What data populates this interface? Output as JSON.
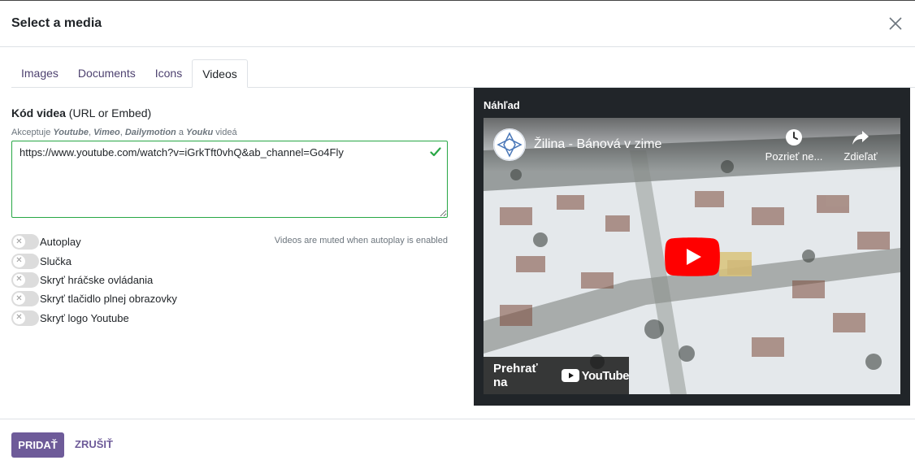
{
  "dialog": {
    "title": "Select a media"
  },
  "tabs": [
    {
      "label": "Images"
    },
    {
      "label": "Documents"
    },
    {
      "label": "Icons"
    },
    {
      "label": "Videos",
      "active": true
    }
  ],
  "form": {
    "label_bold": "Kód videa",
    "label_rest": " (URL or Embed)",
    "help_prefix": "Akceptuje ",
    "help_youtube": "Youtube",
    "help_sep1": ", ",
    "help_vimeo": "Vimeo",
    "help_sep2": ", ",
    "help_dailymotion": "Dailymotion",
    "help_and": " a ",
    "help_youku": "Youku",
    "help_suffix": " videá",
    "url_value": "https://www.youtube.com/watch?v=iGrkTft0vhQ&ab_channel=Go4Fly",
    "autoplay_note": "Videos are muted when autoplay is enabled",
    "toggles": [
      {
        "label": "Autoplay",
        "checked": false
      },
      {
        "label": "Slučka",
        "checked": false
      },
      {
        "label": "Skryť hráčske ovládania",
        "checked": false
      },
      {
        "label": "Skryť tlačidlo plnej obrazovky",
        "checked": false
      },
      {
        "label": "Skryť logo Youtube",
        "checked": false
      }
    ]
  },
  "preview": {
    "title": "Náhľad",
    "video_title": "Žilina - Bánová v zime",
    "watch_later": "Pozrieť ne...",
    "share": "Zdieľať",
    "watch_on": "Prehrať na",
    "youtube_word": "YouTube"
  },
  "footer": {
    "primary_label": "PRIDAŤ",
    "cancel_label": "ZRUŠIŤ"
  },
  "colors": {
    "accent": "#6e5b99",
    "valid": "#28a745",
    "youtube_red": "#ff0000"
  }
}
